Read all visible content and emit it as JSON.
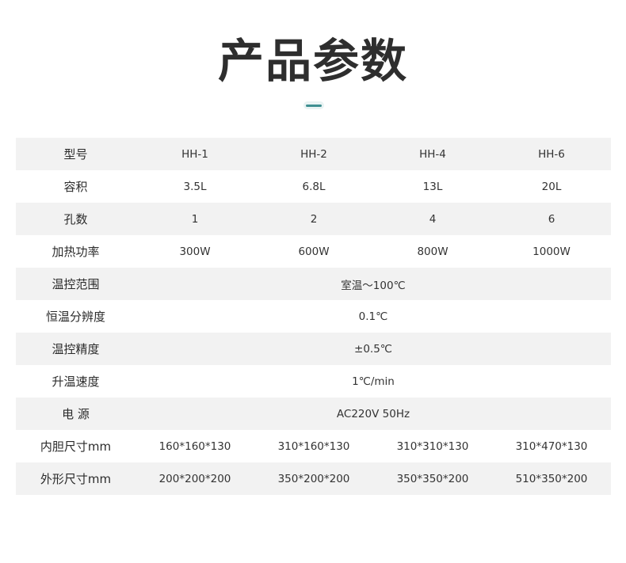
{
  "title": "产品参数",
  "rows": [
    {
      "label": "型号",
      "values": [
        "HH-1",
        "HH-2",
        "HH-4",
        "HH-6"
      ]
    },
    {
      "label": "容积",
      "values": [
        "3.5L",
        "6.8L",
        "13L",
        "20L"
      ]
    },
    {
      "label": "孔数",
      "values": [
        "1",
        "2",
        "4",
        "6"
      ]
    },
    {
      "label": "加热功率",
      "values": [
        "300W",
        "600W",
        "800W",
        "1000W"
      ]
    },
    {
      "label": "温控范围",
      "value": "室温～100℃"
    },
    {
      "label": "恒温分辨度",
      "value": "0.1℃"
    },
    {
      "label": "温控精度",
      "value": "±0.5℃"
    },
    {
      "label": "升温速度",
      "value": "1℃/min"
    },
    {
      "label": "电 源",
      "value": "AC220V 50Hz"
    },
    {
      "label": "内胆尺寸mm",
      "values": [
        "160*160*130",
        "310*160*130",
        "310*310*130",
        "310*470*130"
      ]
    },
    {
      "label": "外形尺寸mm",
      "values": [
        "200*200*200",
        "350*200*200",
        "350*350*200",
        "510*350*200"
      ]
    }
  ],
  "colors": {
    "title": "#2e2e2e",
    "accent": "#3f8f91",
    "row_shade": "#f2f2f2",
    "text": "#333333"
  }
}
